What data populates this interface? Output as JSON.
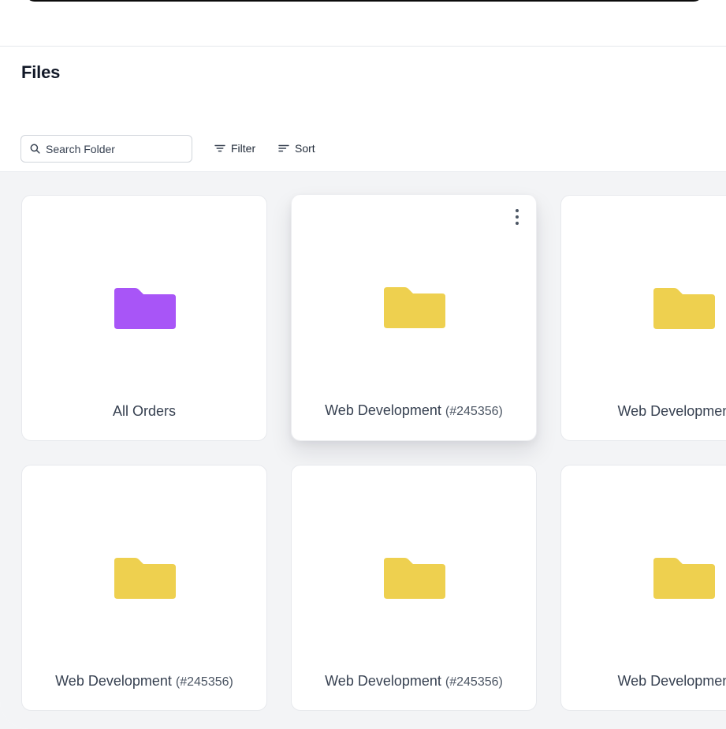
{
  "header": {
    "title": "Files"
  },
  "toolbar": {
    "search_placeholder": "Search Folder",
    "filter_label": "Filter",
    "sort_label": "Sort"
  },
  "folders": [
    {
      "name": "All Orders",
      "id": "",
      "color": "#a855f7"
    },
    {
      "name": "Web Development",
      "id": "(#245356)",
      "color": "#eed04f"
    },
    {
      "name": "Web Development",
      "id": "(#",
      "color": "#eed04f"
    },
    {
      "name": "Web Development",
      "id": "(#245356)",
      "color": "#eed04f"
    },
    {
      "name": "Web Development",
      "id": "(#245356)",
      "color": "#eed04f"
    },
    {
      "name": "Web Development",
      "id": "(#",
      "color": "#eed04f"
    }
  ],
  "colors": {
    "accent_purple": "#a855f7",
    "folder_yellow": "#eed04f",
    "background": "#f3f4f6"
  }
}
